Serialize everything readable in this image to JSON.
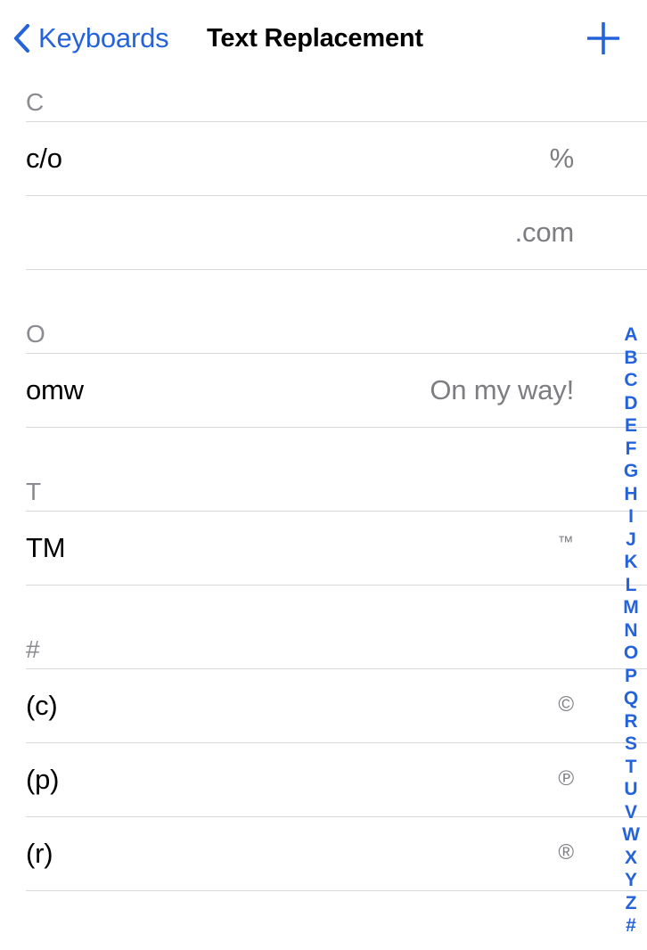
{
  "nav": {
    "back_label": "Keyboards",
    "back_icon": "chevron-left-icon",
    "title": "Text Replacement",
    "add_icon": "plus-icon"
  },
  "colors": {
    "accent": "#2563db",
    "title": "#000000",
    "section_header": "#8b8b90",
    "phrase": "#7d7d82",
    "separator": "#d8d8dc",
    "background": "#ffffff"
  },
  "sections": [
    {
      "header": "C",
      "rows": [
        {
          "shortcut": "c/o",
          "phrase": "%",
          "phrase_style": "normal"
        },
        {
          "shortcut": "",
          "phrase": ".com",
          "phrase_style": "normal"
        }
      ]
    },
    {
      "header": "O",
      "rows": [
        {
          "shortcut": "omw",
          "phrase": "On my way!",
          "phrase_style": "normal"
        }
      ]
    },
    {
      "header": "T",
      "rows": [
        {
          "shortcut": "TM",
          "phrase": "™",
          "phrase_style": "small"
        }
      ]
    },
    {
      "header": "#",
      "rows": [
        {
          "shortcut": "(c)",
          "phrase": "©",
          "phrase_style": "circled"
        },
        {
          "shortcut": "(p)",
          "phrase": "℗",
          "phrase_style": "circled"
        },
        {
          "shortcut": "(r)",
          "phrase": "®",
          "phrase_style": "circled"
        }
      ]
    }
  ],
  "index_bar": {
    "letters": [
      "A",
      "B",
      "C",
      "D",
      "E",
      "F",
      "G",
      "H",
      "I",
      "J",
      "K",
      "L",
      "M",
      "N",
      "O",
      "P",
      "Q",
      "R",
      "S",
      "T",
      "U",
      "V",
      "W",
      "X",
      "Y",
      "Z",
      "#"
    ]
  }
}
